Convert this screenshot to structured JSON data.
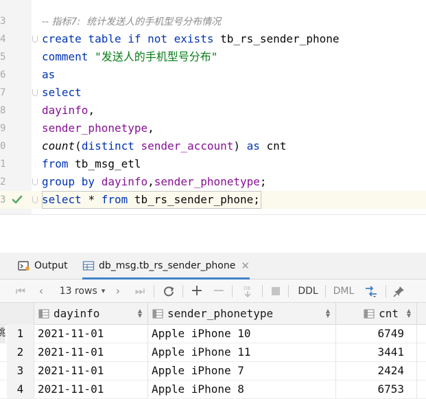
{
  "editor": {
    "lines": [
      {
        "num": "3",
        "tokens": [
          {
            "t": "-- 指标7:  统计发送人的手机型号分布情况",
            "c": "cmt"
          }
        ]
      },
      {
        "num": "4",
        "fold": true,
        "tokens": [
          {
            "t": "create table if not exists ",
            "c": "kw"
          },
          {
            "t": "tb_rs_sender_phone",
            "c": "plain"
          }
        ]
      },
      {
        "num": "5",
        "tokens": [
          {
            "t": "comment ",
            "c": "kw"
          },
          {
            "t": "\"发送人的手机型号分布\"",
            "c": "str"
          }
        ]
      },
      {
        "num": "6",
        "tokens": [
          {
            "t": "as",
            "c": "kw"
          }
        ]
      },
      {
        "num": "7",
        "fold": true,
        "tokens": [
          {
            "t": "select",
            "c": "kw"
          }
        ]
      },
      {
        "num": "8",
        "tokens": [
          {
            "t": "dayinfo",
            "c": "id"
          },
          {
            "t": ",",
            "c": "plain"
          }
        ]
      },
      {
        "num": "9",
        "tokens": [
          {
            "t": "sender_phonetype",
            "c": "id"
          },
          {
            "t": ",",
            "c": "plain"
          }
        ]
      },
      {
        "num": "0",
        "tokens": [
          {
            "t": "count",
            "c": "fn"
          },
          {
            "t": "(",
            "c": "plain"
          },
          {
            "t": "distinct ",
            "c": "kw"
          },
          {
            "t": "sender_account",
            "c": "id"
          },
          {
            "t": ") ",
            "c": "plain"
          },
          {
            "t": "as ",
            "c": "kw"
          },
          {
            "t": "cnt",
            "c": "plain"
          }
        ]
      },
      {
        "num": "1",
        "tokens": [
          {
            "t": "from ",
            "c": "kw"
          },
          {
            "t": "tb_msg_etl",
            "c": "plain"
          }
        ]
      },
      {
        "num": "2",
        "fold": true,
        "tokens": [
          {
            "t": "group by ",
            "c": "kw"
          },
          {
            "t": "dayinfo",
            "c": "id"
          },
          {
            "t": ",",
            "c": "plain"
          },
          {
            "t": "sender_phonetype",
            "c": "id"
          },
          {
            "t": ";",
            "c": "plain"
          }
        ]
      },
      {
        "num": "3",
        "fold": true,
        "current": true,
        "check": true,
        "boxed": true,
        "tokens": [
          {
            "t": "select ",
            "c": "kw"
          },
          {
            "t": "* ",
            "c": "plain"
          },
          {
            "t": "from ",
            "c": "kw"
          },
          {
            "t": "tb_rs_sender_phone",
            "c": "plain"
          },
          {
            "t": ";",
            "c": "plain"
          }
        ]
      }
    ]
  },
  "panel": {
    "tabs": [
      {
        "label": "Output",
        "icon": "output-icon"
      },
      {
        "label": "db_msg.tb_rs_sender_phone",
        "icon": "table-icon",
        "active": true
      }
    ]
  },
  "toolbar": {
    "rows_label": "13 rows",
    "ddl_label": "DDL",
    "dml_label": "DML"
  },
  "grid": {
    "columns": [
      "dayinfo",
      "sender_phonetype",
      "cnt"
    ],
    "rows": [
      {
        "n": "1",
        "dayinfo": "2021-11-01",
        "sender_phonetype": "Apple iPhone 10",
        "cnt": "6749"
      },
      {
        "n": "2",
        "dayinfo": "2021-11-01",
        "sender_phonetype": "Apple iPhone 11",
        "cnt": "3441"
      },
      {
        "n": "3",
        "dayinfo": "2021-11-01",
        "sender_phonetype": "Apple iPhone 7",
        "cnt": "2424"
      },
      {
        "n": "4",
        "dayinfo": "2021-11-01",
        "sender_phonetype": "Apple iPhone 8",
        "cnt": "6753"
      }
    ],
    "side_fragment": "跳"
  },
  "colors": {
    "keyword": "#0033b3",
    "identifier": "#871094",
    "string": "#067d17",
    "comment": "#8c8c8c",
    "accent": "#4083c9",
    "check": "#59a869"
  }
}
